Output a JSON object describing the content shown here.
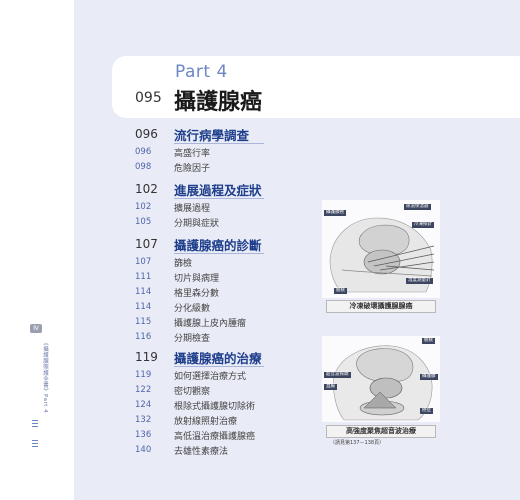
{
  "part": {
    "label": "Part 4",
    "page": "095",
    "title": "攝護腺癌"
  },
  "sections": [
    {
      "page": "096",
      "title": "流行病學調查",
      "items": [
        {
          "page": "096",
          "label": "高盛行率"
        },
        {
          "page": "098",
          "label": "危險因子"
        }
      ]
    },
    {
      "page": "102",
      "title": "進展過程及症狀",
      "items": [
        {
          "page": "102",
          "label": "擴展過程"
        },
        {
          "page": "105",
          "label": "分期與症狀"
        }
      ]
    },
    {
      "page": "107",
      "title": "攝護腺癌的診斷",
      "items": [
        {
          "page": "107",
          "label": "篩檢"
        },
        {
          "page": "111",
          "label": "切片與病理"
        },
        {
          "page": "114",
          "label": "格里森分數"
        },
        {
          "page": "114",
          "label": "分化級數"
        },
        {
          "page": "115",
          "label": "攝護腺上皮內腫瘤"
        },
        {
          "page": "116",
          "label": "分期檢查"
        }
      ]
    },
    {
      "page": "119",
      "title": "攝護腺癌的治療",
      "items": [
        {
          "page": "119",
          "label": "如何選擇治療方式"
        },
        {
          "page": "122",
          "label": "密切觀察"
        },
        {
          "page": "124",
          "label": "根除式攝護腺切除術"
        },
        {
          "page": "132",
          "label": "放射線照射治療"
        },
        {
          "page": "136",
          "label": "高低溫治療攝護腺癌"
        },
        {
          "page": "140",
          "label": "去雄性素療法"
        }
      ]
    }
  ],
  "figures": [
    {
      "caption": "冷凍破壞攝護腺腺癌",
      "labels": [
        "攝護腺癌",
        "尿道保溫器",
        "冷凍探針",
        "溫度測量針",
        "膀胱"
      ]
    },
    {
      "caption": "高強度聚焦超音波治療",
      "note": "（請見第137－138頁）",
      "labels": [
        "膀胱",
        "攝護腺",
        "超音波探頭",
        "直腸",
        "癌症"
      ]
    }
  ],
  "sidebar": {
    "tab": "Ⅳ",
    "text": "《攝護腺照護全書》Part 4"
  }
}
